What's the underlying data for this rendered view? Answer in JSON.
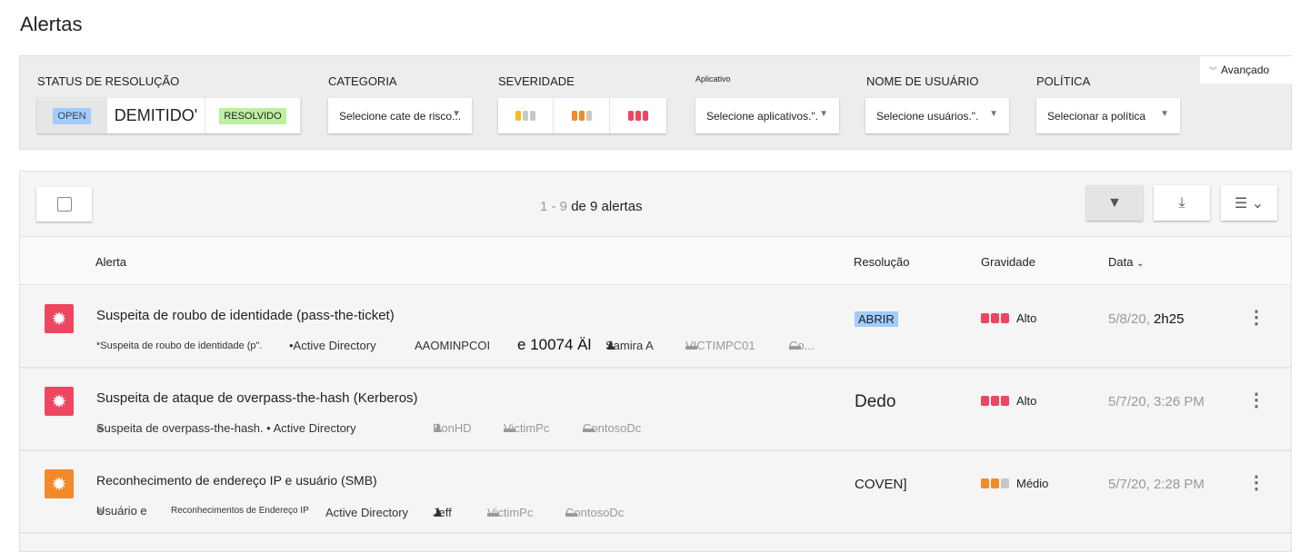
{
  "page_title": "Alertas",
  "filters": {
    "resolution_status": {
      "label": "STATUS DE RESOLUÇÃO",
      "options": [
        "OPEN",
        "DEMITIDO'",
        "RESOLVIDO"
      ]
    },
    "category": {
      "label": "CATEGORIA",
      "placeholder": "Selecione cate de risco..."
    },
    "severity": {
      "label": "SEVERIDADE",
      "options": [
        "low",
        "medium",
        "high"
      ]
    },
    "app": {
      "label": "Aplicativo",
      "placeholder": "Selecione aplicativos.\"."
    },
    "user": {
      "label": "NOME DE USUÁRIO",
      "placeholder": "Selecione usuários.\"."
    },
    "policy": {
      "label": "POLÍTICA",
      "placeholder": "Selecionar a política"
    },
    "advanced": "Avançado"
  },
  "toolbar": {
    "range": "1 - 9",
    "count_suffix": "de 9 alertas"
  },
  "columns": {
    "alert": "Alerta",
    "resolution": "Resolução",
    "severity": "Gravidade",
    "date": "Data"
  },
  "colors": {
    "high": "#ee4560",
    "medium": "#f28a2a",
    "low": "#f5bd1c",
    "inactive": "#c8c8c8",
    "open_badge": "#a2ccfb"
  },
  "alerts": [
    {
      "title": "Suspeita de roubo de identidade (pass-the-ticket)",
      "severity": "high",
      "meta": [
        "*Suspeita de roubo de identidade (p\".",
        "•Active Directory",
        "AAOMINPCOI",
        "e 10074 Äl",
        "Samira A",
        "VICTIMPC01",
        "Co..."
      ],
      "resolution": "ABRIR",
      "severity_label": "Alto",
      "date": "5/8/20,",
      "time": "2h25"
    },
    {
      "title": "Suspeita de ataque de overpass-the-hash (Kerberos)",
      "severity": "high",
      "meta": [
        "Suspeita de overpass-the-hash. • Active Directory",
        "RonHD",
        "VictimPc",
        "ContosoDc"
      ],
      "resolution": "Dedo",
      "severity_label": "Alto",
      "date": "5/7/20, 3:26 PM"
    },
    {
      "title": "Reconhecimento de endereço IP e usuário (SMB)",
      "severity": "medium",
      "meta": [
        "Usuário e",
        "Reconhecimentos de Endereço IP",
        "Active Directory",
        "Jeff",
        "VictimPc",
        "ContosoDc"
      ],
      "resolution": "COVEN]",
      "severity_label": "Médio",
      "date": "5/7/20, 2:28 PM"
    }
  ]
}
